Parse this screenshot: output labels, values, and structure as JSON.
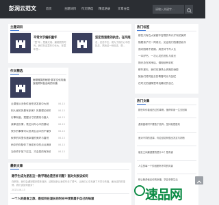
{
  "header": {
    "logo": "彭润云范文",
    "nav": [
      "首页",
      "主题词目",
      "作文精选",
      "精选语录",
      "文章分类"
    ],
    "search_placeholder": "请输入关键字..."
  },
  "topic_section": {
    "title": "主题词目",
    "cards": [
      {
        "title": "平常文字编织童年",
        "desc": "“童”年，是最天真、最美丽的时光，我们在这童年中长大，在童年里..."
      },
      {
        "title": "坚定而温柔的执念，在风雨里舍弃",
        "desc": "念，念念不忘，成为了我们心中的执念，然而这一份执念，是..."
      }
    ]
  },
  "essay_section": {
    "title": "作文精选",
    "feature": {
      "title": "面带微笑的秘密·英字文化内涵及相关特色活动的价值",
      "desc": "面带微笑的秘密，这一秘密在于一个人内心的平和，并且善于观察..."
    },
    "items": [
      {
        "text": "让课堂从无条件信任进发到中大班",
        "date": "06-13"
      },
      {
        "text": "别人家的风景有多美？风景理论研究",
        "date": "06-13"
      },
      {
        "text": "行事有度，把握分寸的原则与做人",
        "date": "06-13"
      },
      {
        "text": "我拿这份情，表达对你心中的感动",
        "date": "06-13"
      },
      {
        "text": "快乐的事情可以抵消生活中的不愉快",
        "date": "06-13"
      },
      {
        "text": "秋季的风里传递幸福的美好与喜悦",
        "date": "06-13"
      },
      {
        "text": "雨中的你陪伴了我成长中的点点滴滴",
        "date": "06-13"
      },
      {
        "text": "当你终于放下过往，才会真的有所收获",
        "date": "06-13"
      }
    ]
  },
  "latest_section": {
    "title": "最新文章",
    "items": [
      {
        "title": "跟学生成为朋友这一教学理念是否有问题？面对失败该如何",
        "desc": "在职场，我们会遇到很多很多挫折，这些挫折让我们失去了勇气，让我们心中充满了不甘与失落。面对这样的事情，我们该如何面对？",
        "meta": "2023-06-13"
      },
      {
        "title": "一个人的美食之旅，是如何在漫长的时光中找到属于自己的味道",
        "desc": "",
        "meta": ""
      }
    ]
  },
  "hot_section": {
    "title": "热门标签",
    "items": [
      "那些只有在大家都不容易的年代才有的美好",
      "陪着孩子们一同成长，见证他们的喜怒哀乐",
      "面对困难不退缩，用坚持书写人生",
      "一本好书，一次心灵的洗礼与成长",
      "阳光总在风雨后，请相信有彩虹",
      "那年夏天，我们在操场上奔跑的身影",
      "致我们终将逝去的青春时光与回忆",
      "在时光的缝隙里寻找最初的自己"
    ]
  },
  "recommend_section": {
    "title": "热门文章",
    "items": [
      "那些年你曾经历过的事情，值得你用一生去回味",
      "遇到困难时不要急于放弃，坚持就是胜利",
      "面对不同的选择，你应该如何做出决定与判断",
      "朋友之间最重要的是什么？是真诚",
      "人生的每一个阶段都有不同的风景",
      "别让焦虑偷走你的幸福，学会享受生活"
    ]
  },
  "colors": {
    "header": "#2b2e33",
    "accent": "#2f6fd6",
    "thumb": "#3a3f5d",
    "watermark": "#0a8a43"
  },
  "watermark": "速品网"
}
